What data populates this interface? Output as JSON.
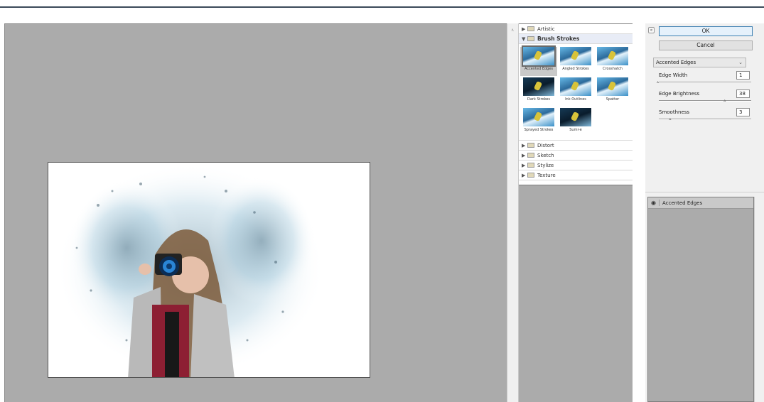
{
  "filter_gallery": {
    "folders_before": [
      {
        "label": "Artistic",
        "expanded": false
      }
    ],
    "open_folder": {
      "label": "Brush Strokes",
      "expanded": true
    },
    "thumbnails": [
      {
        "label": "Accented Edges",
        "selected": true
      },
      {
        "label": "Angled Strokes",
        "selected": false
      },
      {
        "label": "Crosshatch",
        "selected": false
      },
      {
        "label": "Dark Strokes",
        "selected": false
      },
      {
        "label": "Ink Outlines",
        "selected": false
      },
      {
        "label": "Spatter",
        "selected": false
      },
      {
        "label": "Sprayed Strokes",
        "selected": false
      },
      {
        "label": "Sumi-e",
        "selected": false
      }
    ],
    "folders_after": [
      {
        "label": "Distort"
      },
      {
        "label": "Sketch"
      },
      {
        "label": "Stylize"
      },
      {
        "label": "Texture"
      }
    ]
  },
  "settings": {
    "ok_label": "OK",
    "cancel_label": "Cancel",
    "filter_select": "Accented Edges",
    "params": [
      {
        "label": "Edge Width",
        "value": "1",
        "level": 0.0
      },
      {
        "label": "Edge Brightness",
        "value": "38",
        "level": 0.76
      },
      {
        "label": "Smoothness",
        "value": "3",
        "level": 0.14
      }
    ]
  },
  "layers": {
    "items": [
      {
        "label": "Accented Edges",
        "visible": true
      }
    ]
  },
  "colors": {
    "canvas_bg": "#ababab",
    "ok_border": "#3c7fb1"
  }
}
